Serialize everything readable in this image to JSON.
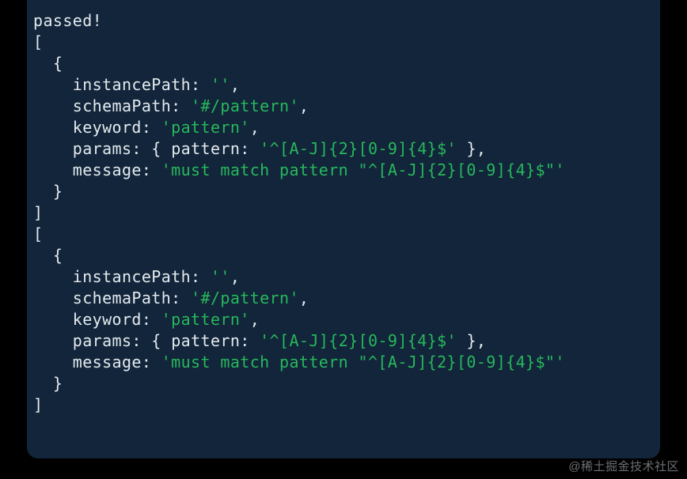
{
  "watermark": "@稀土掘金技术社区",
  "terminal": {
    "header": "passed!",
    "blocks": [
      {
        "instancePath": "''",
        "schemaPath": "'#/pattern'",
        "keyword": "'pattern'",
        "paramsKey": "pattern:",
        "paramsValue": "'^[A-J]{2}[0-9]{4}$'",
        "message": "'must match pattern \"^[A-J]{2}[0-9]{4}$\"'"
      },
      {
        "instancePath": "''",
        "schemaPath": "'#/pattern'",
        "keyword": "'pattern'",
        "paramsKey": "pattern:",
        "paramsValue": "'^[A-J]{2}[0-9]{4}$'",
        "message": "'must match pattern \"^[A-J]{2}[0-9]{4}$\"'"
      }
    ]
  }
}
